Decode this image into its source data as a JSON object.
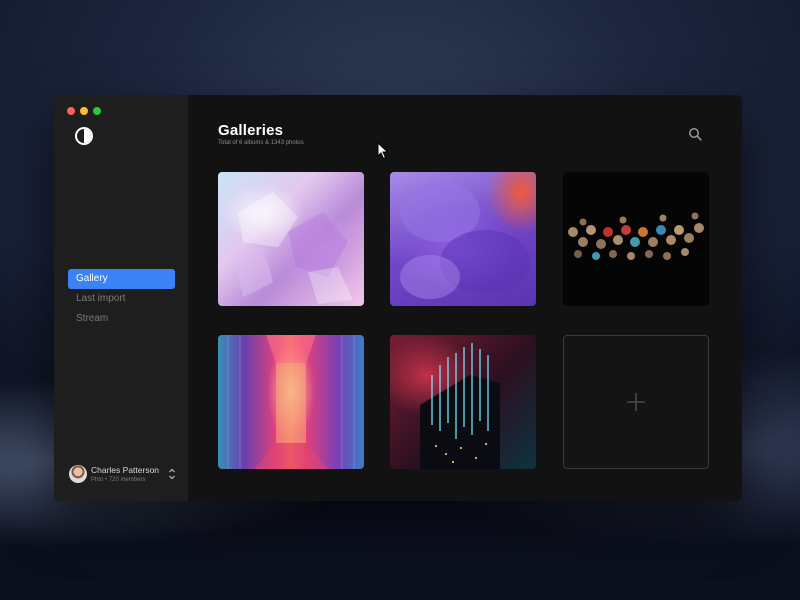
{
  "window": {
    "traffic_lights": {
      "close": "#fe5f57",
      "minimize": "#febc2e",
      "zoom": "#28c840"
    }
  },
  "sidebar": {
    "logo_icon": "half-circle-icon",
    "nav": [
      {
        "label": "Gallery",
        "active": true
      },
      {
        "label": "Last import",
        "active": false
      },
      {
        "label": "Stream",
        "active": false
      }
    ],
    "user": {
      "name": "Charles Patterson",
      "subtitle": "Phto • 720 members"
    }
  },
  "main": {
    "title": "Galleries",
    "subtitle": "Total of 6 albums & 1343 photos",
    "search_icon": "search-icon",
    "tiles": [
      {
        "kind": "photo",
        "subject": "crystals"
      },
      {
        "kind": "photo",
        "subject": "purple-smoke"
      },
      {
        "kind": "photo",
        "subject": "bokeh-lights"
      },
      {
        "kind": "photo",
        "subject": "neon-corridor"
      },
      {
        "kind": "photo",
        "subject": "neon-building"
      },
      {
        "kind": "add",
        "icon": "plus-icon"
      }
    ]
  },
  "colors": {
    "accent": "#3b82f6",
    "window_bg": "#121212",
    "sidebar_bg": "#1e1e1e"
  }
}
